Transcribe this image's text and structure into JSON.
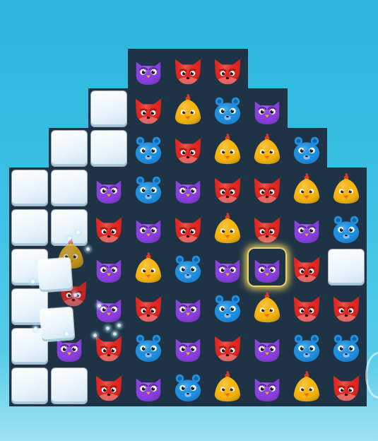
{
  "colors": {
    "owl": "#8b3fe0",
    "fox": "#e0251f",
    "bear": "#1e8fe0",
    "chick": "#f6b40e",
    "board": "#1f3347",
    "ice": "#eaf5fb"
  },
  "board": {
    "columns": 9,
    "rows": 9,
    "grid": [
      [
        ".",
        ".",
        ".",
        "owl",
        "fox",
        "fox",
        ".",
        ".",
        "."
      ],
      [
        ".",
        ".",
        "ice",
        "fox",
        "chick",
        "bear",
        "owl",
        ".",
        "."
      ],
      [
        ".",
        "ice",
        "ice",
        "bear",
        "fox",
        "chick",
        "chick",
        "bear",
        "."
      ],
      [
        "ice",
        "ice",
        "owl",
        "bear",
        "owl",
        "fox",
        "fox",
        "chick",
        "chick"
      ],
      [
        "ice",
        "ice",
        "fox",
        "owl",
        "fox",
        "chick",
        "fox",
        "owl",
        "bear"
      ],
      [
        "ice",
        "empty",
        "owl",
        "chick",
        "bear",
        "owl",
        "owl*",
        "fox",
        "ice"
      ],
      [
        "ice",
        "empty",
        "owl",
        "fox",
        "owl",
        "bear",
        "chick",
        "fox",
        "fox"
      ],
      [
        "ice",
        "owl",
        "fox",
        "bear",
        "owl",
        "fox",
        "owl",
        "bear",
        "bear"
      ],
      [
        "ice",
        "ice",
        "fox",
        "owl",
        "bear",
        "chick",
        "owl",
        "chick",
        "fox"
      ]
    ],
    "selected_piece": "owl",
    "falling_pieces": [
      "chick",
      "fox"
    ]
  }
}
